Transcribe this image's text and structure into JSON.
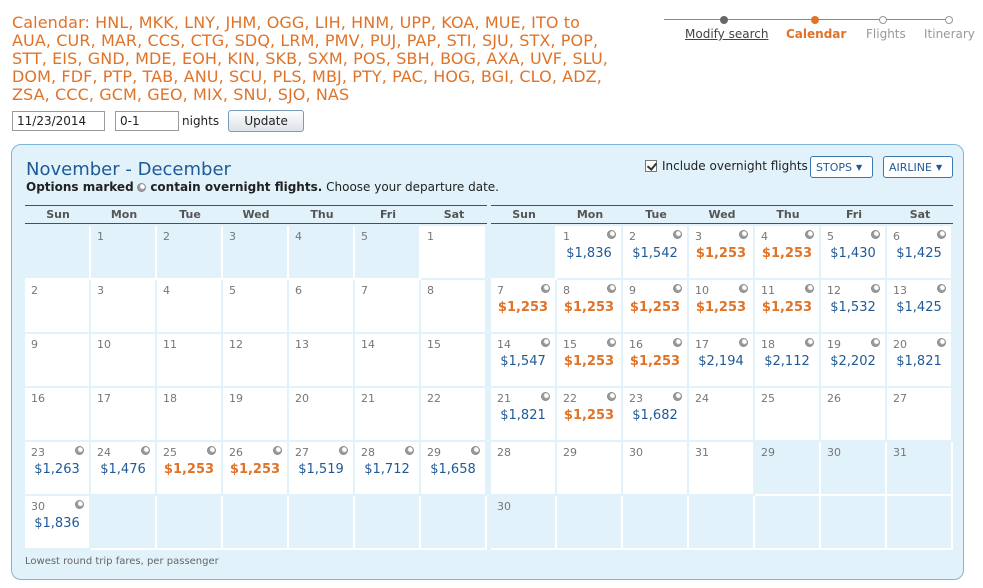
{
  "route_title": "Calendar: HNL, MKK, LNY, JHM, OGG, LIH, HNM, UPP, KOA, MUE, ITO to AUA, CUR, MAR, CCS, CTG, SDQ, LRM, PMV, PUJ, PAP, STI, SJU, STX, POP, STT, EIS, GND, MDE, EOH, KIN, SKB, SXM, POS, SBH, BOG, AXA, UVF, SLU, DOM, FDF, PTP, TAB, ANU, SCU, PLS, MBJ, PTY, PAC, HOG, BGI, CLO, ADZ, ZSA, CCC, GCM, GEO, MIX, SNU, SJO, NAS",
  "search": {
    "date_value": "11/23/2014",
    "nights_value": "0-1",
    "nights_label": "nights",
    "update_label": "Update"
  },
  "progress": {
    "modify": "Modify search",
    "calendar": "Calendar",
    "flights": "Flights",
    "itinerary": "Itinerary"
  },
  "panel": {
    "month_title": "November - December",
    "legend_bold_1": "Options marked",
    "legend_bold_2": "contain overnight flights.",
    "legend_rest": "Choose your departure date.",
    "overnight_label": "Include overnight flights",
    "overnight_checked": true,
    "stops_label": "STOPS",
    "airline_label": "AIRLINE",
    "footer_note": "Lowest round trip fares, per passenger"
  },
  "weekdays": [
    "Sun",
    "Mon",
    "Tue",
    "Wed",
    "Thu",
    "Fri",
    "Sat"
  ],
  "colors": {
    "accent": "#e07328",
    "brand": "#1f5a96",
    "panel_bg": "#e1f2fb"
  },
  "months": [
    {
      "cells": [
        {
          "day": "",
          "off": true
        },
        {
          "day": "1",
          "off": true
        },
        {
          "day": "2",
          "off": true
        },
        {
          "day": "3",
          "off": true
        },
        {
          "day": "4",
          "off": true
        },
        {
          "day": "5",
          "off": true
        },
        {
          "day": "1"
        },
        {
          "day": "2"
        },
        {
          "day": "3"
        },
        {
          "day": "4"
        },
        {
          "day": "5"
        },
        {
          "day": "6"
        },
        {
          "day": "7"
        },
        {
          "day": "8"
        },
        {
          "day": "9"
        },
        {
          "day": "10"
        },
        {
          "day": "11"
        },
        {
          "day": "12"
        },
        {
          "day": "13"
        },
        {
          "day": "14"
        },
        {
          "day": "15"
        },
        {
          "day": "16"
        },
        {
          "day": "17"
        },
        {
          "day": "18"
        },
        {
          "day": "19"
        },
        {
          "day": "20"
        },
        {
          "day": "21"
        },
        {
          "day": "22"
        },
        {
          "day": "23",
          "price": "$1,263",
          "moon": true
        },
        {
          "day": "24",
          "price": "$1,476",
          "moon": true
        },
        {
          "day": "25",
          "price": "$1,253",
          "low": true,
          "moon": true
        },
        {
          "day": "26",
          "price": "$1,253",
          "low": true,
          "moon": true
        },
        {
          "day": "27",
          "price": "$1,519",
          "moon": true
        },
        {
          "day": "28",
          "price": "$1,712",
          "moon": true
        },
        {
          "day": "29",
          "price": "$1,658",
          "moon": true
        },
        {
          "day": "30",
          "price": "$1,836",
          "moon": true
        },
        {
          "day": "",
          "off": true
        },
        {
          "day": "",
          "off": true
        },
        {
          "day": "",
          "off": true
        },
        {
          "day": "",
          "off": true
        },
        {
          "day": "",
          "off": true
        },
        {
          "day": "",
          "off": true
        }
      ]
    },
    {
      "cells": [
        {
          "day": "",
          "off": true
        },
        {
          "day": "1",
          "price": "$1,836",
          "moon": true
        },
        {
          "day": "2",
          "price": "$1,542",
          "moon": true
        },
        {
          "day": "3",
          "price": "$1,253",
          "low": true,
          "moon": true
        },
        {
          "day": "4",
          "price": "$1,253",
          "low": true,
          "moon": true
        },
        {
          "day": "5",
          "price": "$1,430",
          "moon": true
        },
        {
          "day": "6",
          "price": "$1,425",
          "moon": true
        },
        {
          "day": "7",
          "price": "$1,253",
          "low": true,
          "moon": true
        },
        {
          "day": "8",
          "price": "$1,253",
          "low": true,
          "moon": true
        },
        {
          "day": "9",
          "price": "$1,253",
          "low": true,
          "moon": true
        },
        {
          "day": "10",
          "price": "$1,253",
          "low": true,
          "moon": true
        },
        {
          "day": "11",
          "price": "$1,253",
          "low": true,
          "moon": true
        },
        {
          "day": "12",
          "price": "$1,532",
          "moon": true
        },
        {
          "day": "13",
          "price": "$1,425",
          "moon": true
        },
        {
          "day": "14",
          "price": "$1,547",
          "moon": true
        },
        {
          "day": "15",
          "price": "$1,253",
          "low": true,
          "moon": true
        },
        {
          "day": "16",
          "price": "$1,253",
          "low": true,
          "moon": true
        },
        {
          "day": "17",
          "price": "$2,194",
          "moon": true
        },
        {
          "day": "18",
          "price": "$2,112",
          "moon": true
        },
        {
          "day": "19",
          "price": "$2,202",
          "moon": true
        },
        {
          "day": "20",
          "price": "$1,821",
          "moon": true
        },
        {
          "day": "21",
          "price": "$1,821",
          "moon": true
        },
        {
          "day": "22",
          "price": "$1,253",
          "low": true,
          "moon": true
        },
        {
          "day": "23",
          "price": "$1,682",
          "moon": true
        },
        {
          "day": "24"
        },
        {
          "day": "25"
        },
        {
          "day": "26"
        },
        {
          "day": "27"
        },
        {
          "day": "28"
        },
        {
          "day": "29"
        },
        {
          "day": "30"
        },
        {
          "day": "31"
        },
        {
          "day": "29",
          "off": true
        },
        {
          "day": "30",
          "off": true
        },
        {
          "day": "31",
          "off": true
        },
        {
          "day": "30",
          "off": true
        },
        {
          "day": "",
          "off": true
        },
        {
          "day": "",
          "off": true
        },
        {
          "day": "",
          "off": true
        },
        {
          "day": "",
          "off": true
        },
        {
          "day": "",
          "off": true
        },
        {
          "day": "",
          "off": true
        }
      ]
    }
  ]
}
